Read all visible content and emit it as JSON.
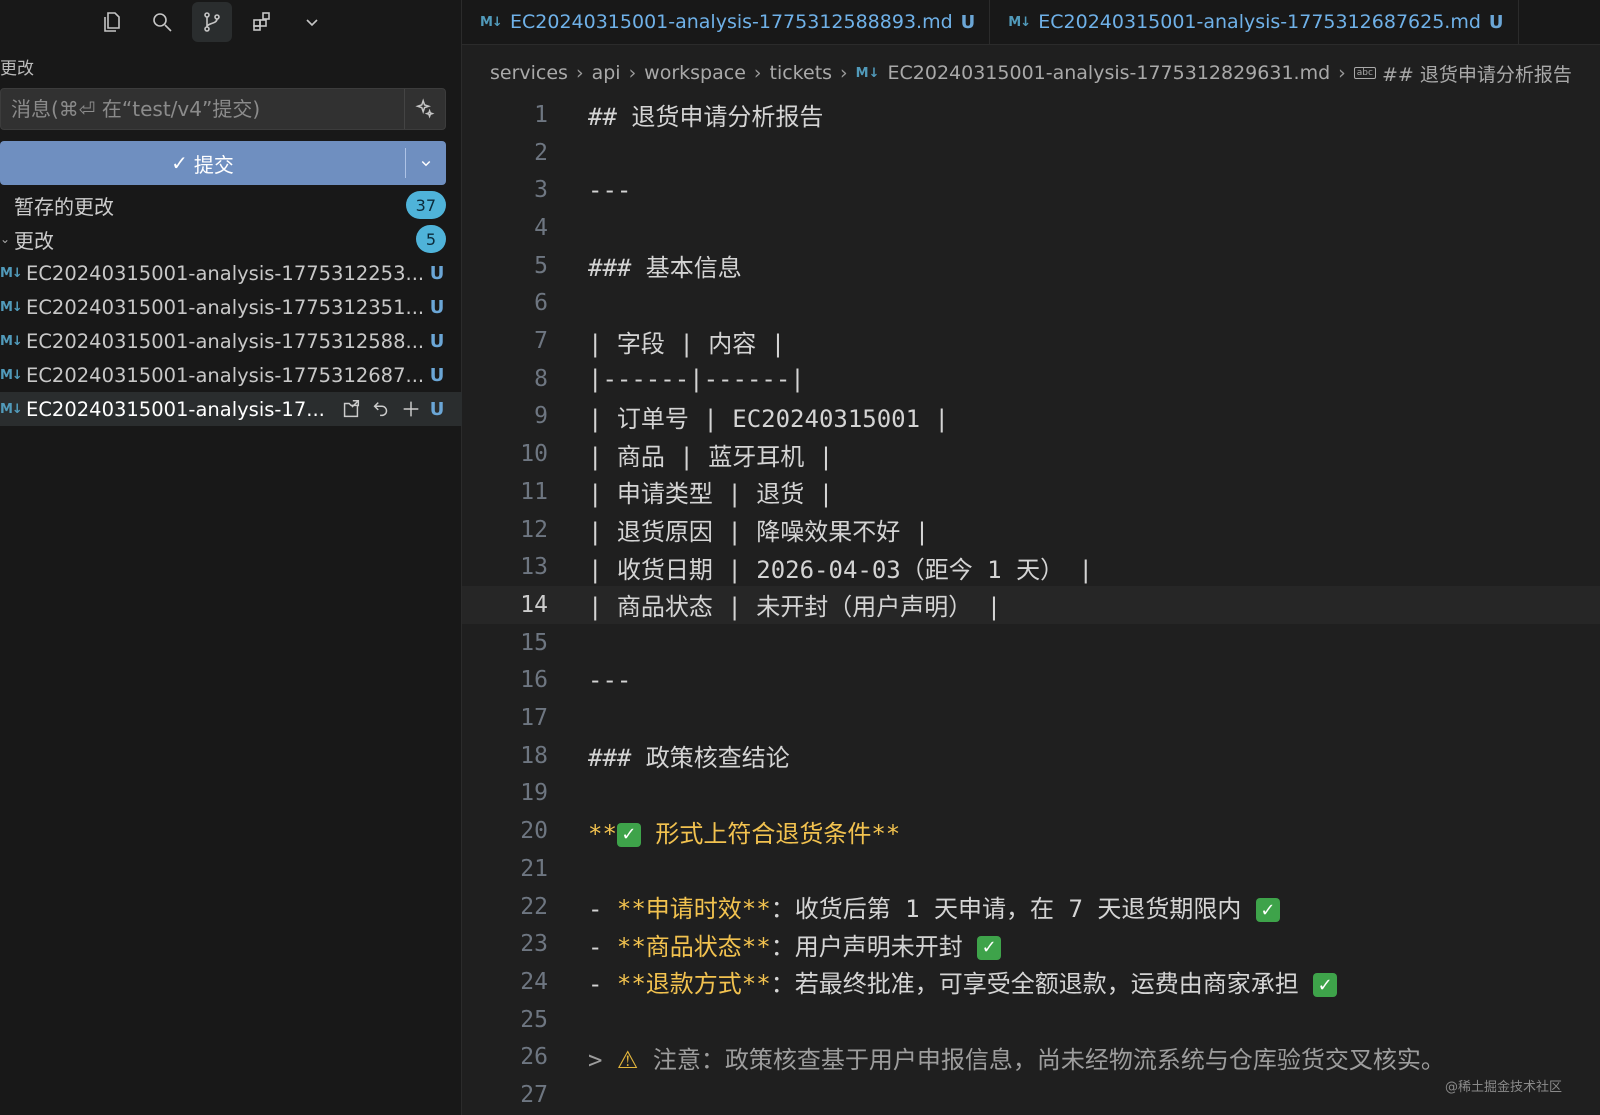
{
  "sidebar": {
    "section_title": "更改",
    "message_placeholder": "消息(⌘⏎ 在“test/v4”提交)",
    "commit_label": "提交",
    "staged_label": "暂存的更改",
    "staged_count": "37",
    "changes_label": "更改",
    "changes_count": "5",
    "files": [
      {
        "name": "EC20240315001-analysis-1775312253...",
        "status": "U"
      },
      {
        "name": "EC20240315001-analysis-1775312351...",
        "status": "U"
      },
      {
        "name": "EC20240315001-analysis-1775312588...",
        "status": "U"
      },
      {
        "name": "EC20240315001-analysis-1775312687...",
        "status": "U"
      },
      {
        "name": "EC20240315001-analysis-17...",
        "status": "U"
      }
    ]
  },
  "tabs": [
    {
      "label": "EC20240315001-analysis-1775312588893.md",
      "status": "U"
    },
    {
      "label": "EC20240315001-analysis-1775312687625.md",
      "status": "U"
    }
  ],
  "breadcrumb": {
    "parts": [
      "services",
      "api",
      "workspace",
      "tickets"
    ],
    "file": "EC20240315001-analysis-1775312829631.md",
    "symbol": "## 退货申请分析报告"
  },
  "editor": {
    "current_line": 14,
    "lines": [
      "## 退货申请分析报告",
      "",
      "---",
      "",
      "### 基本信息",
      "",
      "| 字段 | 内容 |",
      "|------|------|",
      "| 订单号 | EC20240315001 |",
      "| 商品 | 蓝牙耳机 |",
      "| 申请类型 | 退货 |",
      "| 退货原因 | 降噪效果不好 |",
      "| 收货日期 | 2026-04-03（距今 1 天） |",
      "| 商品状态 | 未开封（用户声明） |",
      "",
      "---",
      "",
      "### 政策核查结论",
      "",
      "**✅ 形式上符合退货条件**",
      "",
      "- **申请时效**：收货后第 1 天申请，在 7 天退货期限内 ✅",
      "- **商品状态**：用户声明未开封 ✅",
      "- **退款方式**：若最终批准，可享受全额退款，运费由商家承担 ✅",
      "",
      "> ⚠️ 注意：政策核查基于用户申报信息，尚未经物流系统与仓库验货交叉核实。",
      ""
    ]
  },
  "watermark": "@稀土掘金技术社区"
}
